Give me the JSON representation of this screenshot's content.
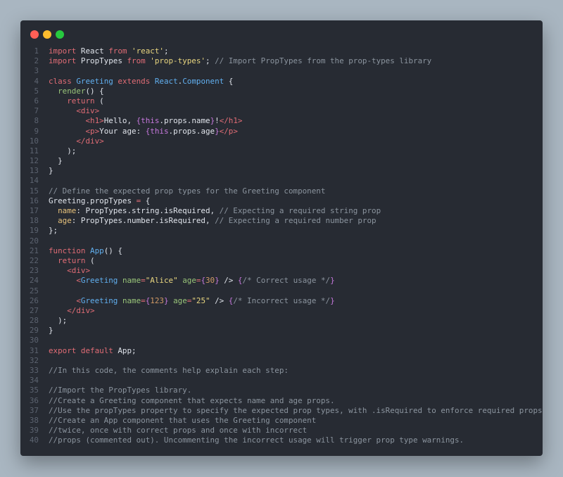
{
  "window": {
    "traffic_lights": [
      "close",
      "minimize",
      "zoom"
    ]
  },
  "colors": {
    "keyword": "#e06c75",
    "keyword2": "#c678dd",
    "string": "#e8d57f",
    "class": "#61afef",
    "comment": "#8b949e",
    "tag": "#e06c75",
    "attr": "#e5c07b",
    "number": "#d19a66",
    "function": "#98c379",
    "text": "#dfe3ea",
    "background": "#272b33",
    "line_number": "#5c6370"
  },
  "code_lines": [
    [
      [
        "kw",
        "import"
      ],
      [
        "text",
        " React "
      ],
      [
        "kw",
        "from"
      ],
      [
        "text",
        " "
      ],
      [
        "str",
        "'react'"
      ],
      [
        "text",
        ";"
      ]
    ],
    [
      [
        "kw",
        "import"
      ],
      [
        "text",
        " PropTypes "
      ],
      [
        "kw",
        "from"
      ],
      [
        "text",
        " "
      ],
      [
        "str",
        "'prop-types'"
      ],
      [
        "text",
        "; "
      ],
      [
        "cmt",
        "// Import PropTypes from the prop-types library"
      ]
    ],
    [],
    [
      [
        "kw",
        "class"
      ],
      [
        "text",
        " "
      ],
      [
        "cls",
        "Greeting"
      ],
      [
        "text",
        " "
      ],
      [
        "kw",
        "extends"
      ],
      [
        "text",
        " "
      ],
      [
        "cls",
        "React"
      ],
      [
        "text",
        "."
      ],
      [
        "cls",
        "Component"
      ],
      [
        "text",
        " {"
      ]
    ],
    [
      [
        "text",
        "  "
      ],
      [
        "fn",
        "render"
      ],
      [
        "text",
        "() {"
      ]
    ],
    [
      [
        "text",
        "    "
      ],
      [
        "kw",
        "return"
      ],
      [
        "text",
        " ("
      ]
    ],
    [
      [
        "text",
        "      "
      ],
      [
        "tag",
        "<div>"
      ]
    ],
    [
      [
        "text",
        "        "
      ],
      [
        "tag",
        "<h1>"
      ],
      [
        "text",
        "Hello, "
      ],
      [
        "kw2",
        "{"
      ],
      [
        "kw2",
        "this"
      ],
      [
        "text",
        "."
      ],
      [
        "text",
        "props"
      ],
      [
        "text",
        "."
      ],
      [
        "text",
        "name"
      ],
      [
        "kw2",
        "}"
      ],
      [
        "text",
        "!"
      ],
      [
        "tag",
        "</h1>"
      ]
    ],
    [
      [
        "text",
        "        "
      ],
      [
        "tag",
        "<p>"
      ],
      [
        "text",
        "Your age: "
      ],
      [
        "kw2",
        "{"
      ],
      [
        "kw2",
        "this"
      ],
      [
        "text",
        "."
      ],
      [
        "text",
        "props"
      ],
      [
        "text",
        "."
      ],
      [
        "text",
        "age"
      ],
      [
        "kw2",
        "}"
      ],
      [
        "tag",
        "</p>"
      ]
    ],
    [
      [
        "text",
        "      "
      ],
      [
        "tag",
        "</div>"
      ]
    ],
    [
      [
        "text",
        "    );"
      ]
    ],
    [
      [
        "text",
        "  }"
      ]
    ],
    [
      [
        "text",
        "}"
      ]
    ],
    [],
    [
      [
        "cmt",
        "// Define the expected prop types for the Greeting component"
      ]
    ],
    [
      [
        "text",
        "Greeting"
      ],
      [
        "text",
        "."
      ],
      [
        "text",
        "propTypes "
      ],
      [
        "kw",
        "="
      ],
      [
        "text",
        " {"
      ]
    ],
    [
      [
        "text",
        "  "
      ],
      [
        "attr",
        "name"
      ],
      [
        "text",
        ": PropTypes"
      ],
      [
        "text",
        "."
      ],
      [
        "text",
        "string"
      ],
      [
        "text",
        "."
      ],
      [
        "text",
        "isRequired, "
      ],
      [
        "cmt",
        "// Expecting a required string prop"
      ]
    ],
    [
      [
        "text",
        "  "
      ],
      [
        "attr",
        "age"
      ],
      [
        "text",
        ": PropTypes"
      ],
      [
        "text",
        "."
      ],
      [
        "text",
        "number"
      ],
      [
        "text",
        "."
      ],
      [
        "text",
        "isRequired, "
      ],
      [
        "cmt",
        "// Expecting a required number prop"
      ]
    ],
    [
      [
        "text",
        "};"
      ]
    ],
    [],
    [
      [
        "kw",
        "function"
      ],
      [
        "text",
        " "
      ],
      [
        "cls",
        "App"
      ],
      [
        "text",
        "() {"
      ]
    ],
    [
      [
        "text",
        "  "
      ],
      [
        "kw",
        "return"
      ],
      [
        "text",
        " ("
      ]
    ],
    [
      [
        "text",
        "    "
      ],
      [
        "tag",
        "<div>"
      ]
    ],
    [
      [
        "text",
        "      "
      ],
      [
        "tag",
        "<"
      ],
      [
        "cls",
        "Greeting"
      ],
      [
        "text",
        " "
      ],
      [
        "fn",
        "name"
      ],
      [
        "kw",
        "="
      ],
      [
        "str",
        "\"Alice\""
      ],
      [
        "text",
        " "
      ],
      [
        "fn",
        "age"
      ],
      [
        "kw",
        "="
      ],
      [
        "kw2",
        "{"
      ],
      [
        "num",
        "30"
      ],
      [
        "kw2",
        "}"
      ],
      [
        "text",
        " /> "
      ],
      [
        "kw2",
        "{"
      ],
      [
        "cmt",
        "/* Correct usage */"
      ],
      [
        "kw2",
        "}"
      ]
    ],
    [],
    [
      [
        "text",
        "      "
      ],
      [
        "tag",
        "<"
      ],
      [
        "cls",
        "Greeting"
      ],
      [
        "text",
        " "
      ],
      [
        "fn",
        "name"
      ],
      [
        "kw",
        "="
      ],
      [
        "kw2",
        "{"
      ],
      [
        "num",
        "123"
      ],
      [
        "kw2",
        "}"
      ],
      [
        "text",
        " "
      ],
      [
        "fn",
        "age"
      ],
      [
        "kw",
        "="
      ],
      [
        "str",
        "\"25\""
      ],
      [
        "text",
        " /> "
      ],
      [
        "kw2",
        "{"
      ],
      [
        "cmt",
        "/* Incorrect usage */"
      ],
      [
        "kw2",
        "}"
      ]
    ],
    [
      [
        "text",
        "    "
      ],
      [
        "tag",
        "</div>"
      ]
    ],
    [
      [
        "text",
        "  );"
      ]
    ],
    [
      [
        "text",
        "}"
      ]
    ],
    [],
    [
      [
        "kw",
        "export"
      ],
      [
        "text",
        " "
      ],
      [
        "kw",
        "default"
      ],
      [
        "text",
        " App;"
      ]
    ],
    [],
    [
      [
        "cmt",
        "//In this code, the comments help explain each step:"
      ]
    ],
    [],
    [
      [
        "cmt",
        "//Import the PropTypes library."
      ]
    ],
    [
      [
        "cmt",
        "//Create a Greeting component that expects name and age props."
      ]
    ],
    [
      [
        "cmt",
        "//Use the propTypes property to specify the expected prop types, with .isRequired to enforce required props."
      ]
    ],
    [
      [
        "cmt",
        "//Create an App component that uses the Greeting component"
      ]
    ],
    [
      [
        "cmt",
        "//twice, once with correct props and once with incorrect"
      ]
    ],
    [
      [
        "cmt",
        "//props (commented out). Uncommenting the incorrect usage will trigger prop type warnings."
      ]
    ]
  ]
}
